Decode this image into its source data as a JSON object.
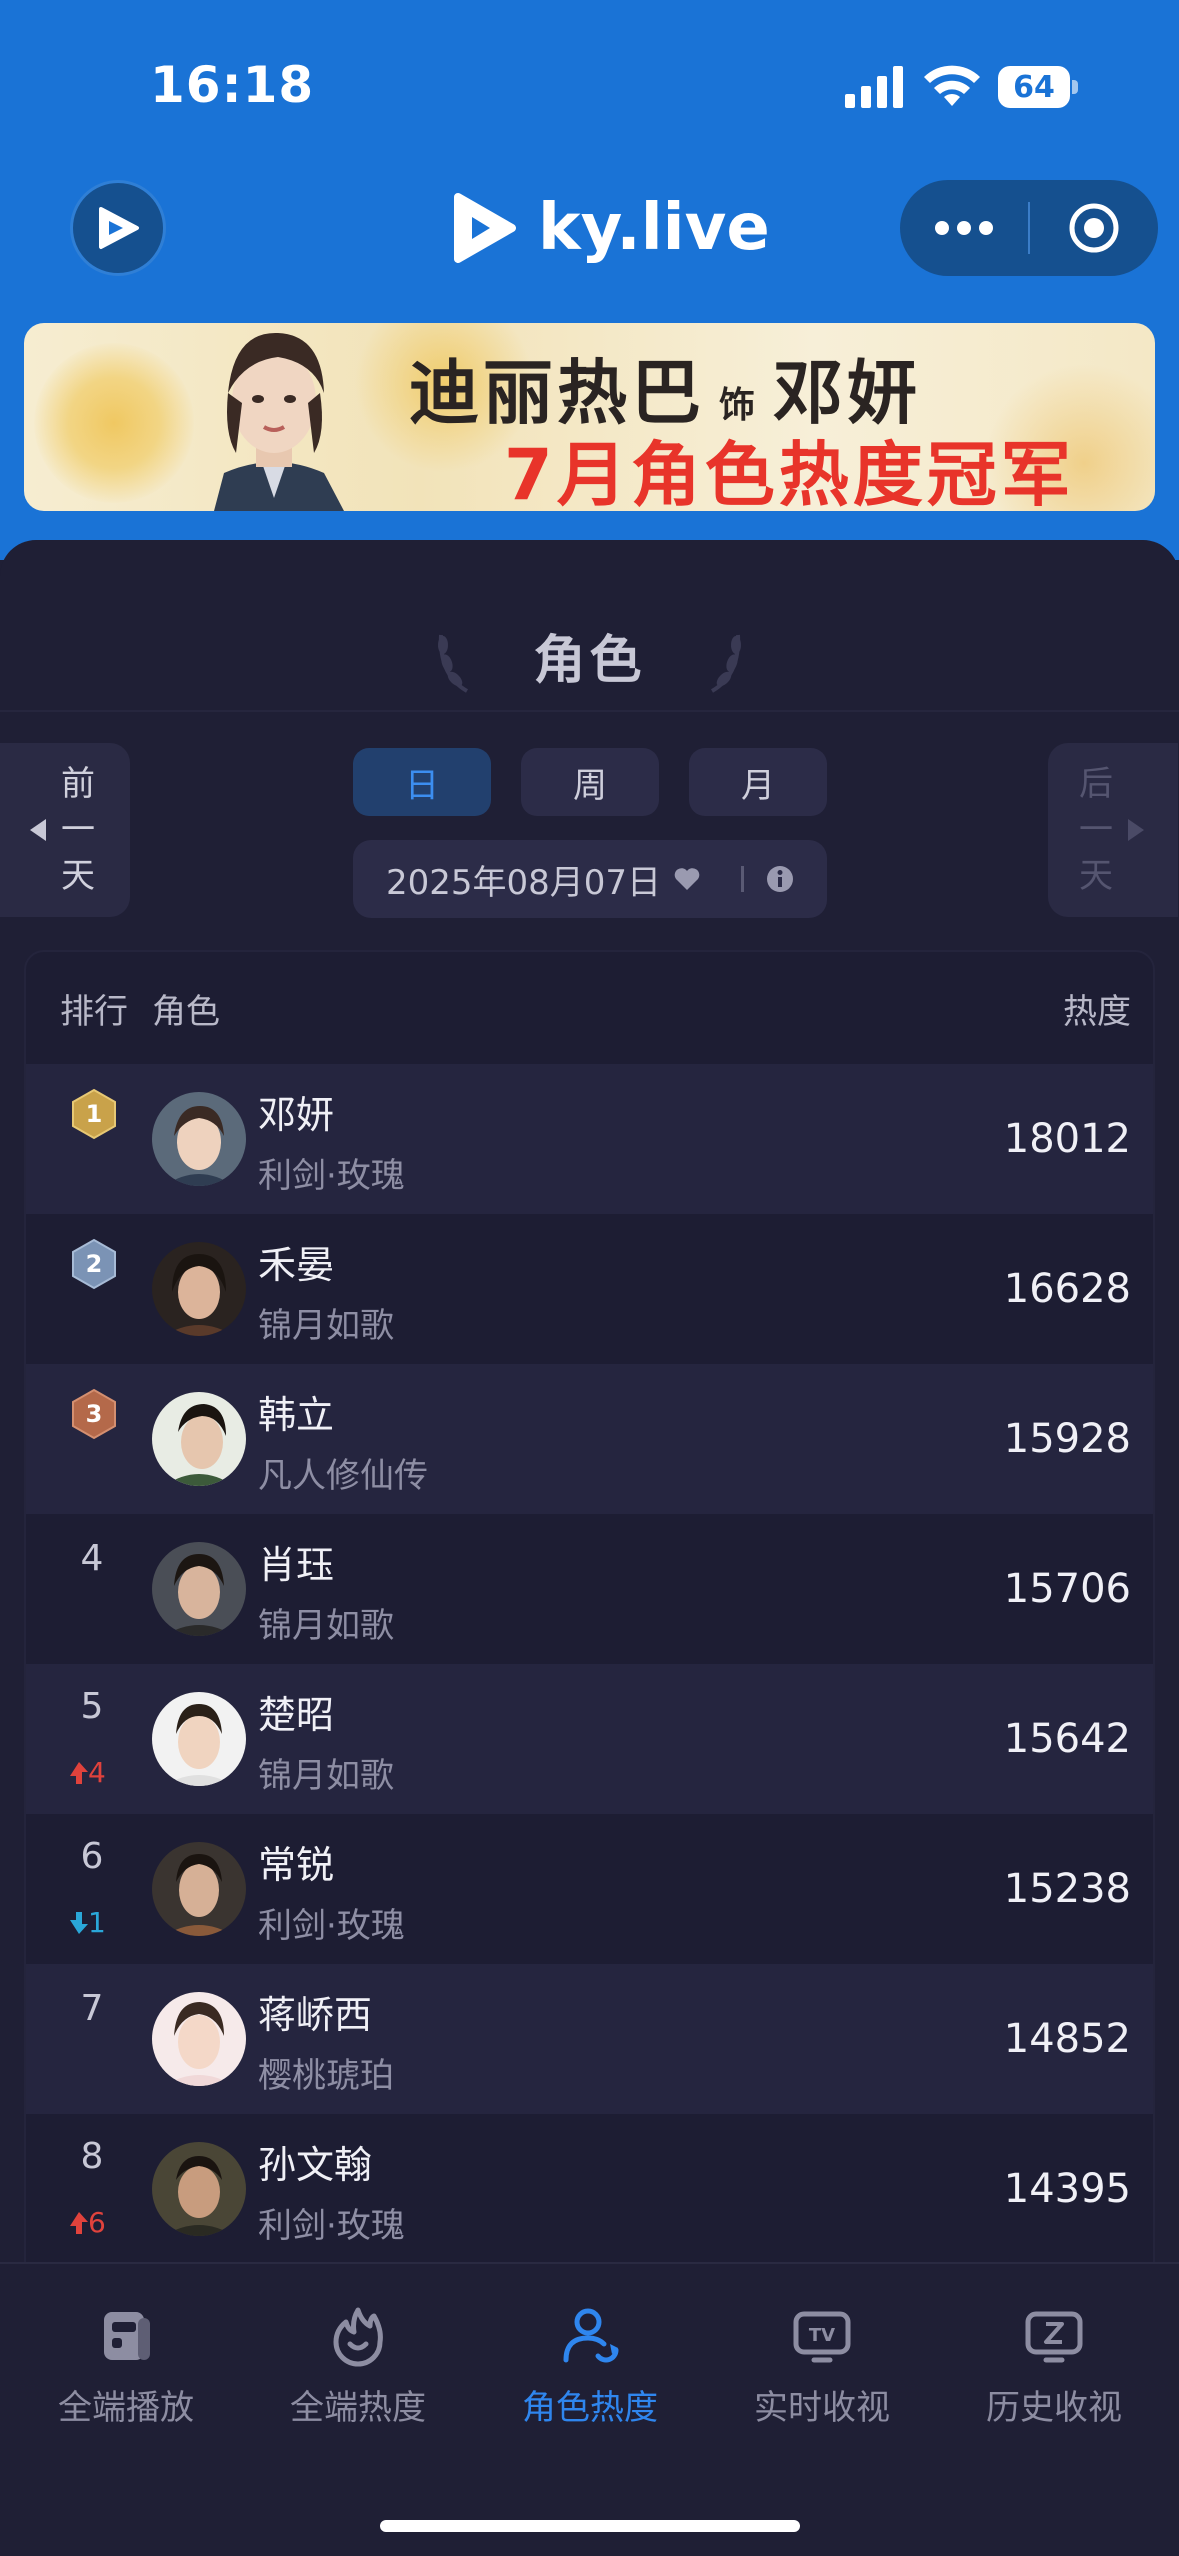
{
  "status_bar": {
    "time": "16:18",
    "battery": "64"
  },
  "nav": {
    "brand": "ky.live"
  },
  "banner": {
    "actress": "迪丽热巴",
    "as_label": "饰",
    "role": "邓妍",
    "headline": "7月角色热度冠军"
  },
  "page_title": "角色",
  "side_nav": {
    "prev": [
      "前",
      "一",
      "天"
    ],
    "next": [
      "后",
      "一",
      "天"
    ]
  },
  "period_tabs": [
    {
      "label": "日",
      "active": true
    },
    {
      "label": "周",
      "active": false
    },
    {
      "label": "月",
      "active": false
    }
  ],
  "date": "2025年08月07日",
  "table": {
    "headers": {
      "rank": "排行",
      "role": "角色",
      "heat": "热度"
    },
    "rows": [
      {
        "rank": "1",
        "change": "",
        "change_dir": "",
        "name": "邓妍",
        "drama": "利剑·玫瑰",
        "heat": "18012"
      },
      {
        "rank": "2",
        "change": "",
        "change_dir": "",
        "name": "禾晏",
        "drama": "锦月如歌",
        "heat": "16628"
      },
      {
        "rank": "3",
        "change": "",
        "change_dir": "",
        "name": "韩立",
        "drama": "凡人修仙传",
        "heat": "15928"
      },
      {
        "rank": "4",
        "change": "",
        "change_dir": "",
        "name": "肖珏",
        "drama": "锦月如歌",
        "heat": "15706"
      },
      {
        "rank": "5",
        "change": "4",
        "change_dir": "up",
        "name": "楚昭",
        "drama": "锦月如歌",
        "heat": "15642"
      },
      {
        "rank": "6",
        "change": "1",
        "change_dir": "down",
        "name": "常锐",
        "drama": "利剑·玫瑰",
        "heat": "15238"
      },
      {
        "rank": "7",
        "change": "",
        "change_dir": "",
        "name": "蒋峤西",
        "drama": "樱桃琥珀",
        "heat": "14852"
      },
      {
        "rank": "8",
        "change": "6",
        "change_dir": "up",
        "name": "孙文翰",
        "drama": "利剑·玫瑰",
        "heat": "14395"
      }
    ]
  },
  "tabbar": [
    {
      "label": "全端播放",
      "icon": "playback-icon",
      "active": false
    },
    {
      "label": "全端热度",
      "icon": "flame-icon",
      "active": false
    },
    {
      "label": "角色热度",
      "icon": "person-refresh-icon",
      "active": true
    },
    {
      "label": "实时收视",
      "icon": "tv-icon",
      "active": false
    },
    {
      "label": "历史收视",
      "icon": "history-tv-icon",
      "active": false
    }
  ],
  "colors": {
    "accent": "#2f86ee",
    "header_blue": "#1a73d6",
    "up": "#e0423c",
    "down": "#2aa7d8",
    "gold": "#c9a24a",
    "silver": "#7b93b5",
    "bronze": "#b4694a"
  }
}
